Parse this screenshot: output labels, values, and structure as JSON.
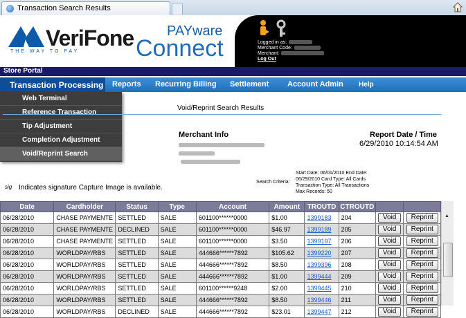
{
  "browser": {
    "tab_title": "Transaction Search Results"
  },
  "header": {
    "logo_word": "VeriFone",
    "logo_tagline": "THE WAY TO PAY",
    "product_top": "PAYware",
    "product_bottom": "Connect",
    "login_label": "Logged in as:",
    "merchant_code_label": "Merchant Code:",
    "merchant_label": "Merchant:",
    "logout_label": "Log Out"
  },
  "portal": {
    "label": "Store Portal"
  },
  "nav": {
    "items": [
      "Transaction Processing",
      "Reports",
      "Recurring Billing",
      "Settlement",
      "Account Admin",
      "Help"
    ],
    "dropdown": [
      "Web Terminal",
      "Reference Transaction",
      "Tip Adjustment",
      "Completion Adjustment",
      "Void/Reprint Search"
    ]
  },
  "content": {
    "title": "Void/Reprint Search Results",
    "merchant_info": "Merchant Info",
    "report_date_label": "Report Date / Time",
    "report_date": "6/29/2010 10:14:54 AM",
    "criteria_label": "Search Criteria:",
    "criteria_lines": [
      "Start Date: 06/01/2010 End Date:",
      "06/29/2010 Card Type: All Cards",
      "Transaction Type: All Transactions",
      "Max Records: 50"
    ],
    "sig_icon": "sig",
    "sig_note": "Indicates signature Capture Image is available."
  },
  "table": {
    "headers": [
      "Date",
      "Cardholder",
      "Status",
      "Type",
      "Account",
      "Amount",
      "TROUTD",
      "CTROUTD",
      "",
      ""
    ],
    "void_label": "Void",
    "reprint_label": "Reprint",
    "rows": [
      [
        "06/28/2010",
        "CHASE PAYMENTE",
        "SETTLED",
        "SALE",
        "601100******0000",
        "$1.00",
        "1399183",
        "204"
      ],
      [
        "06/28/2010",
        "CHASE PAYMENTE",
        "DECLINED",
        "SALE",
        "601100******0000",
        "$46.97",
        "1399189",
        "205"
      ],
      [
        "06/28/2010",
        "CHASE PAYMENTE",
        "SETTLED",
        "SALE",
        "601100******0000",
        "$3.50",
        "1399197",
        "206"
      ],
      [
        "06/28/2010",
        "WORLDPAY/RBS",
        "SETTLED",
        "SALE",
        "444666******7892",
        "$105.62",
        "1399220",
        "207"
      ],
      [
        "06/28/2010",
        "WORLDPAY/RBS",
        "SETTLED",
        "SALE",
        "444666******7892",
        "$8.50",
        "1399396",
        "208"
      ],
      [
        "06/28/2010",
        "WORLDPAY/RBS",
        "SETTLED",
        "SALE",
        "444666******7892",
        "$1.00",
        "1399444",
        "209"
      ],
      [
        "06/28/2010",
        "WORLDPAY/RBS",
        "SETTLED",
        "SALE",
        "601100******9248",
        "$2.00",
        "1399445",
        "210"
      ],
      [
        "06/28/2010",
        "WORLDPAY/RBS",
        "SETTLED",
        "SALE",
        "444666******7892",
        "$8.50",
        "1399446",
        "211"
      ],
      [
        "06/28/2010",
        "WORLDPAY/RBS",
        "DECLINED",
        "SALE",
        "444666******7892",
        "$23.01",
        "1399447",
        "212"
      ]
    ]
  },
  "colors": {
    "nav": "#1e6fbd",
    "portal": "#1a1a6a",
    "dropdown": "#3d3d3d",
    "table_header": "#7c7c9a",
    "link": "#1a5cc8"
  }
}
